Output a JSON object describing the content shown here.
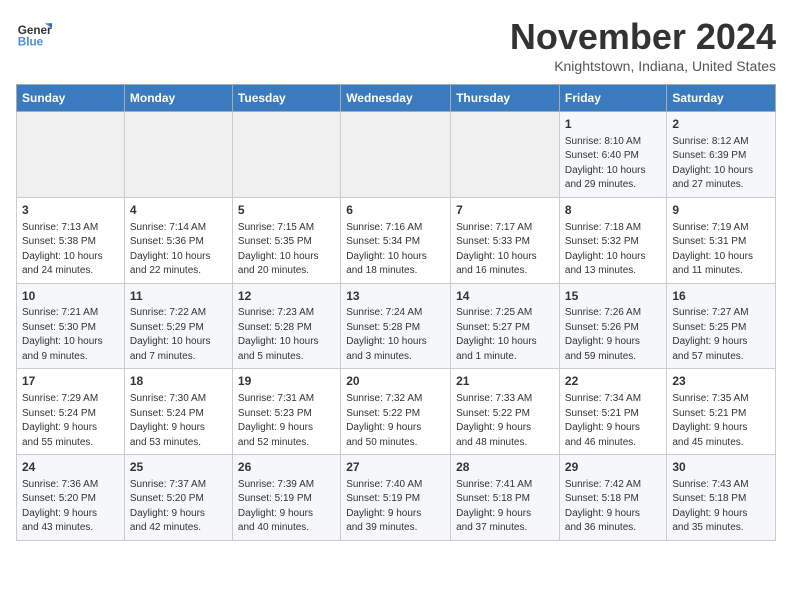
{
  "logo": {
    "line1": "General",
    "line2": "Blue"
  },
  "title": "November 2024",
  "subtitle": "Knightstown, Indiana, United States",
  "days_of_week": [
    "Sunday",
    "Monday",
    "Tuesday",
    "Wednesday",
    "Thursday",
    "Friday",
    "Saturday"
  ],
  "weeks": [
    [
      {
        "day": "",
        "info": ""
      },
      {
        "day": "",
        "info": ""
      },
      {
        "day": "",
        "info": ""
      },
      {
        "day": "",
        "info": ""
      },
      {
        "day": "",
        "info": ""
      },
      {
        "day": "1",
        "info": "Sunrise: 8:10 AM\nSunset: 6:40 PM\nDaylight: 10 hours\nand 29 minutes."
      },
      {
        "day": "2",
        "info": "Sunrise: 8:12 AM\nSunset: 6:39 PM\nDaylight: 10 hours\nand 27 minutes."
      }
    ],
    [
      {
        "day": "3",
        "info": "Sunrise: 7:13 AM\nSunset: 5:38 PM\nDaylight: 10 hours\nand 24 minutes."
      },
      {
        "day": "4",
        "info": "Sunrise: 7:14 AM\nSunset: 5:36 PM\nDaylight: 10 hours\nand 22 minutes."
      },
      {
        "day": "5",
        "info": "Sunrise: 7:15 AM\nSunset: 5:35 PM\nDaylight: 10 hours\nand 20 minutes."
      },
      {
        "day": "6",
        "info": "Sunrise: 7:16 AM\nSunset: 5:34 PM\nDaylight: 10 hours\nand 18 minutes."
      },
      {
        "day": "7",
        "info": "Sunrise: 7:17 AM\nSunset: 5:33 PM\nDaylight: 10 hours\nand 16 minutes."
      },
      {
        "day": "8",
        "info": "Sunrise: 7:18 AM\nSunset: 5:32 PM\nDaylight: 10 hours\nand 13 minutes."
      },
      {
        "day": "9",
        "info": "Sunrise: 7:19 AM\nSunset: 5:31 PM\nDaylight: 10 hours\nand 11 minutes."
      }
    ],
    [
      {
        "day": "10",
        "info": "Sunrise: 7:21 AM\nSunset: 5:30 PM\nDaylight: 10 hours\nand 9 minutes."
      },
      {
        "day": "11",
        "info": "Sunrise: 7:22 AM\nSunset: 5:29 PM\nDaylight: 10 hours\nand 7 minutes."
      },
      {
        "day": "12",
        "info": "Sunrise: 7:23 AM\nSunset: 5:28 PM\nDaylight: 10 hours\nand 5 minutes."
      },
      {
        "day": "13",
        "info": "Sunrise: 7:24 AM\nSunset: 5:28 PM\nDaylight: 10 hours\nand 3 minutes."
      },
      {
        "day": "14",
        "info": "Sunrise: 7:25 AM\nSunset: 5:27 PM\nDaylight: 10 hours\nand 1 minute."
      },
      {
        "day": "15",
        "info": "Sunrise: 7:26 AM\nSunset: 5:26 PM\nDaylight: 9 hours\nand 59 minutes."
      },
      {
        "day": "16",
        "info": "Sunrise: 7:27 AM\nSunset: 5:25 PM\nDaylight: 9 hours\nand 57 minutes."
      }
    ],
    [
      {
        "day": "17",
        "info": "Sunrise: 7:29 AM\nSunset: 5:24 PM\nDaylight: 9 hours\nand 55 minutes."
      },
      {
        "day": "18",
        "info": "Sunrise: 7:30 AM\nSunset: 5:24 PM\nDaylight: 9 hours\nand 53 minutes."
      },
      {
        "day": "19",
        "info": "Sunrise: 7:31 AM\nSunset: 5:23 PM\nDaylight: 9 hours\nand 52 minutes."
      },
      {
        "day": "20",
        "info": "Sunrise: 7:32 AM\nSunset: 5:22 PM\nDaylight: 9 hours\nand 50 minutes."
      },
      {
        "day": "21",
        "info": "Sunrise: 7:33 AM\nSunset: 5:22 PM\nDaylight: 9 hours\nand 48 minutes."
      },
      {
        "day": "22",
        "info": "Sunrise: 7:34 AM\nSunset: 5:21 PM\nDaylight: 9 hours\nand 46 minutes."
      },
      {
        "day": "23",
        "info": "Sunrise: 7:35 AM\nSunset: 5:21 PM\nDaylight: 9 hours\nand 45 minutes."
      }
    ],
    [
      {
        "day": "24",
        "info": "Sunrise: 7:36 AM\nSunset: 5:20 PM\nDaylight: 9 hours\nand 43 minutes."
      },
      {
        "day": "25",
        "info": "Sunrise: 7:37 AM\nSunset: 5:20 PM\nDaylight: 9 hours\nand 42 minutes."
      },
      {
        "day": "26",
        "info": "Sunrise: 7:39 AM\nSunset: 5:19 PM\nDaylight: 9 hours\nand 40 minutes."
      },
      {
        "day": "27",
        "info": "Sunrise: 7:40 AM\nSunset: 5:19 PM\nDaylight: 9 hours\nand 39 minutes."
      },
      {
        "day": "28",
        "info": "Sunrise: 7:41 AM\nSunset: 5:18 PM\nDaylight: 9 hours\nand 37 minutes."
      },
      {
        "day": "29",
        "info": "Sunrise: 7:42 AM\nSunset: 5:18 PM\nDaylight: 9 hours\nand 36 minutes."
      },
      {
        "day": "30",
        "info": "Sunrise: 7:43 AM\nSunset: 5:18 PM\nDaylight: 9 hours\nand 35 minutes."
      }
    ]
  ]
}
